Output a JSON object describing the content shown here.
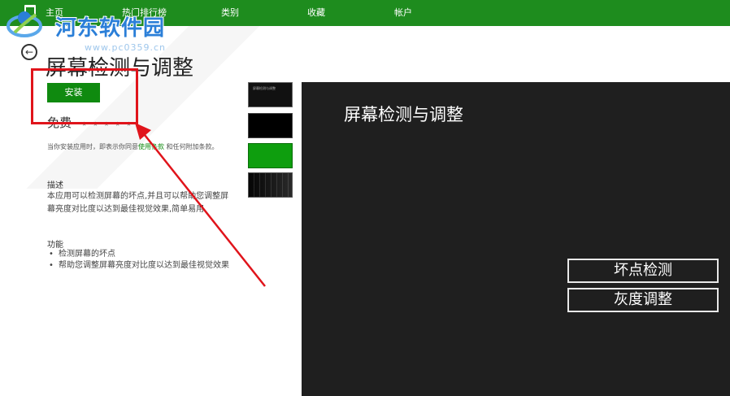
{
  "nav": {
    "items": [
      "主页",
      "热门排行榜",
      "类别",
      "收藏",
      "帐户"
    ]
  },
  "watermark": {
    "text": "河东软件园",
    "sub": "www.pc0359.cn"
  },
  "app": {
    "title": "屏幕检测与调整",
    "install_label": "安装",
    "price": "免费",
    "rating": "★ ★ ★ ★ ★",
    "terms_before": "当你安装应用时，即表示你同意",
    "terms_link": "使用条款",
    "terms_after": "和任何附加条款。",
    "description_heading": "描述",
    "description": "本应用可以检测屏幕的坏点,并且可以帮助您调整屏幕亮度对比度以达到最佳视觉效果,简单易用.",
    "features_heading": "功能",
    "features": [
      "检测屏幕的坏点",
      "帮助您调整屏幕亮度对比度以达到最佳视觉效果"
    ]
  },
  "thumbnails": [
    {
      "name": "screenshot-1",
      "mini_text": "屏幕检测与调整"
    },
    {
      "name": "screenshot-2"
    },
    {
      "name": "screenshot-3"
    },
    {
      "name": "screenshot-4"
    }
  ],
  "preview": {
    "title": "屏幕检测与调整",
    "buttons": [
      "坏点检测",
      "灰度调整"
    ]
  },
  "colors": {
    "nav_bar": "#1e8c1e",
    "install_button": "#0f8a0f",
    "highlight": "#e0141b",
    "preview_bg": "#1f1f1f"
  }
}
